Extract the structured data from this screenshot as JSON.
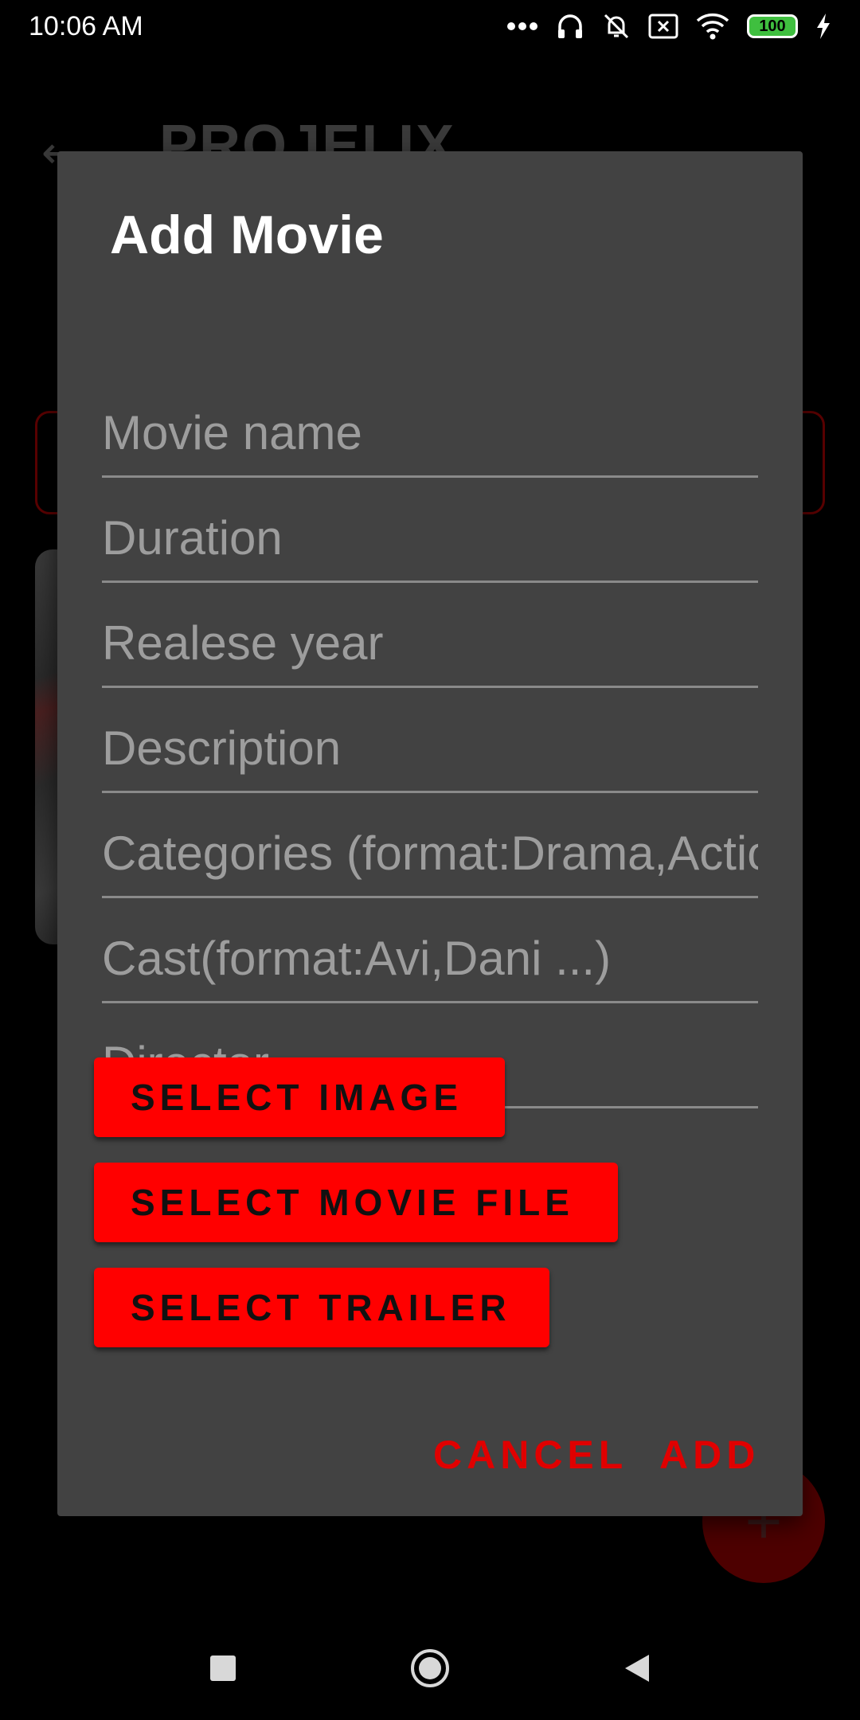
{
  "status_bar": {
    "time": "10:06 AM",
    "battery": "100",
    "icons": [
      "more-dots-icon",
      "headset-icon",
      "bell-off-icon",
      "sim-x-icon",
      "wifi-icon",
      "battery-icon",
      "charging-icon"
    ]
  },
  "background": {
    "title": "PROJELIX",
    "back_icon": "arrow-left-icon"
  },
  "dialog": {
    "title": "Add Movie",
    "fields": [
      {
        "placeholder": "Movie name"
      },
      {
        "placeholder": "Duration"
      },
      {
        "placeholder": "Realese year"
      },
      {
        "placeholder": "Description"
      },
      {
        "placeholder": "Categories (format:Drama,Action ...)"
      },
      {
        "placeholder": "Cast(format:Avi,Dani ...)"
      },
      {
        "placeholder": "Director"
      }
    ],
    "buttons": {
      "select_image": "SELECT IMAGE",
      "select_movie_file": "SELECT MOVIE FILE",
      "select_trailer": "SELECT TRAILER"
    },
    "actions": {
      "cancel": "CANCEL",
      "add": "ADD"
    }
  },
  "nav_bar": {
    "icons": [
      "recents-square-icon",
      "home-circle-icon",
      "back-triangle-icon"
    ]
  },
  "colors": {
    "accent": "#ff0000",
    "dialog_bg": "#424242",
    "background": "#000000"
  }
}
